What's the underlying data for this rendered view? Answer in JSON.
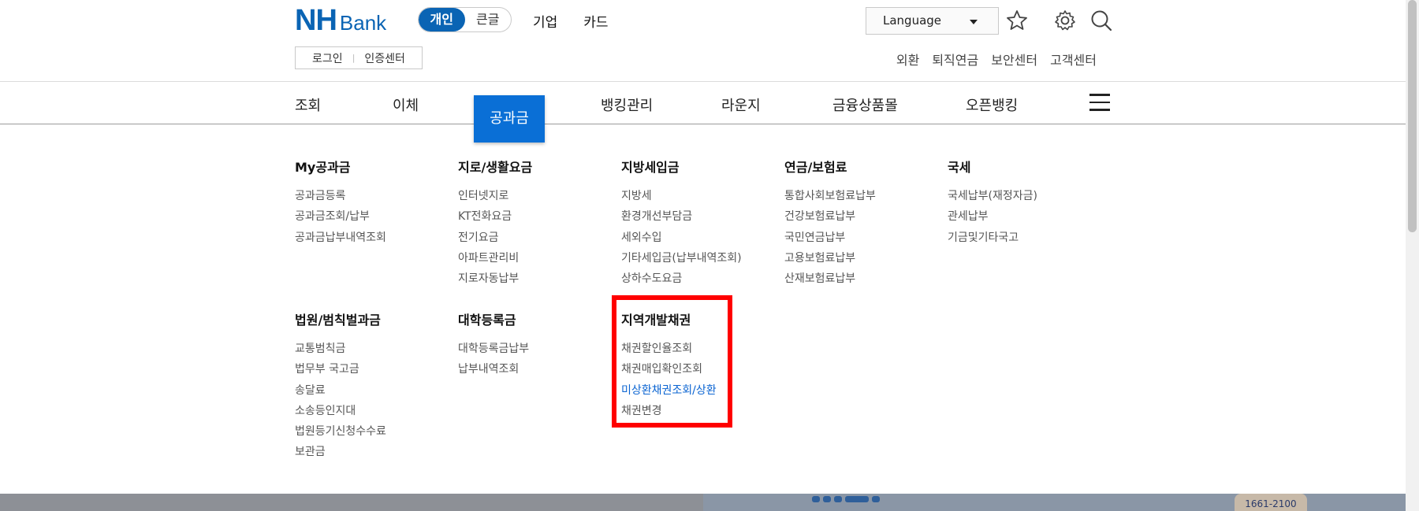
{
  "brand": {
    "logo_main": "NH",
    "logo_sub": "Bank",
    "color": "#0a64b4"
  },
  "size_toggle": {
    "personal": "개인",
    "large_text": "큰글"
  },
  "top_menu": [
    "기업",
    "카드"
  ],
  "language": {
    "label": "Language"
  },
  "icons": {
    "favorite": "star-icon",
    "settings": "gear-icon",
    "search": "search-icon",
    "menu": "hamburger-menu-icon"
  },
  "login": {
    "login": "로그인",
    "cert": "인증센터"
  },
  "util_links": [
    "외환",
    "퇴직연금",
    "보안센터",
    "고객센터"
  ],
  "gnb": {
    "items": [
      "조회",
      "이체",
      "뱅킹관리",
      "라운지",
      "금융상품몰",
      "오픈뱅킹"
    ],
    "active": "공과금",
    "active_color": "#0a6fd6"
  },
  "mega": [
    {
      "title": "My공과금",
      "items": [
        "공과금등록",
        "공과금조회/납부",
        "공과금납부내역조회"
      ]
    },
    {
      "title": "지로/생활요금",
      "items": [
        "인터넷지로",
        "KT전화요금",
        "전기요금",
        "아파트관리비",
        "지로자동납부"
      ]
    },
    {
      "title": "지방세입금",
      "items": [
        "지방세",
        "환경개선부담금",
        "세외수입",
        "기타세입금(납부내역조회)",
        "상하수도요금"
      ]
    },
    {
      "title": "연금/보험료",
      "items": [
        "통합사회보험료납부",
        "건강보험료납부",
        "국민연금납부",
        "고용보험료납부",
        "산재보험료납부"
      ]
    },
    {
      "title": "국세",
      "items": [
        "국세납부(재정자금)",
        "관세납부",
        "기금및기타국고"
      ]
    },
    {
      "title": "법원/범칙벌과금",
      "items": [
        "교통범칙금",
        "법무부 국고금",
        "송달료",
        "소송등인지대",
        "법원등기신청수수료",
        "보관금"
      ]
    },
    {
      "title": "대학등록금",
      "items": [
        "대학등록금납부",
        "납부내역조회"
      ]
    },
    {
      "title": "지역개발채권",
      "items": [
        "채권할인율조회",
        "채권매입확인조회",
        "미상환채권조회/상환",
        "채권변경"
      ],
      "active_index": 2
    }
  ],
  "highlight_color": "#ff0000",
  "bottom_badge": "1661-2100"
}
